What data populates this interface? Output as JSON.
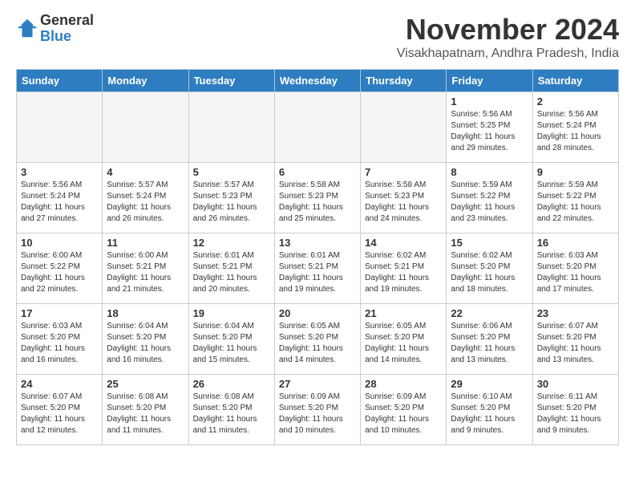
{
  "logo": {
    "general": "General",
    "blue": "Blue"
  },
  "title": "November 2024",
  "location": "Visakhapatnam, Andhra Pradesh, India",
  "weekdays": [
    "Sunday",
    "Monday",
    "Tuesday",
    "Wednesday",
    "Thursday",
    "Friday",
    "Saturday"
  ],
  "weeks": [
    [
      {
        "day": "",
        "info": ""
      },
      {
        "day": "",
        "info": ""
      },
      {
        "day": "",
        "info": ""
      },
      {
        "day": "",
        "info": ""
      },
      {
        "day": "",
        "info": ""
      },
      {
        "day": "1",
        "info": "Sunrise: 5:56 AM\nSunset: 5:25 PM\nDaylight: 11 hours\nand 29 minutes."
      },
      {
        "day": "2",
        "info": "Sunrise: 5:56 AM\nSunset: 5:24 PM\nDaylight: 11 hours\nand 28 minutes."
      }
    ],
    [
      {
        "day": "3",
        "info": "Sunrise: 5:56 AM\nSunset: 5:24 PM\nDaylight: 11 hours\nand 27 minutes."
      },
      {
        "day": "4",
        "info": "Sunrise: 5:57 AM\nSunset: 5:24 PM\nDaylight: 11 hours\nand 26 minutes."
      },
      {
        "day": "5",
        "info": "Sunrise: 5:57 AM\nSunset: 5:23 PM\nDaylight: 11 hours\nand 26 minutes."
      },
      {
        "day": "6",
        "info": "Sunrise: 5:58 AM\nSunset: 5:23 PM\nDaylight: 11 hours\nand 25 minutes."
      },
      {
        "day": "7",
        "info": "Sunrise: 5:58 AM\nSunset: 5:23 PM\nDaylight: 11 hours\nand 24 minutes."
      },
      {
        "day": "8",
        "info": "Sunrise: 5:59 AM\nSunset: 5:22 PM\nDaylight: 11 hours\nand 23 minutes."
      },
      {
        "day": "9",
        "info": "Sunrise: 5:59 AM\nSunset: 5:22 PM\nDaylight: 11 hours\nand 22 minutes."
      }
    ],
    [
      {
        "day": "10",
        "info": "Sunrise: 6:00 AM\nSunset: 5:22 PM\nDaylight: 11 hours\nand 22 minutes."
      },
      {
        "day": "11",
        "info": "Sunrise: 6:00 AM\nSunset: 5:21 PM\nDaylight: 11 hours\nand 21 minutes."
      },
      {
        "day": "12",
        "info": "Sunrise: 6:01 AM\nSunset: 5:21 PM\nDaylight: 11 hours\nand 20 minutes."
      },
      {
        "day": "13",
        "info": "Sunrise: 6:01 AM\nSunset: 5:21 PM\nDaylight: 11 hours\nand 19 minutes."
      },
      {
        "day": "14",
        "info": "Sunrise: 6:02 AM\nSunset: 5:21 PM\nDaylight: 11 hours\nand 19 minutes."
      },
      {
        "day": "15",
        "info": "Sunrise: 6:02 AM\nSunset: 5:20 PM\nDaylight: 11 hours\nand 18 minutes."
      },
      {
        "day": "16",
        "info": "Sunrise: 6:03 AM\nSunset: 5:20 PM\nDaylight: 11 hours\nand 17 minutes."
      }
    ],
    [
      {
        "day": "17",
        "info": "Sunrise: 6:03 AM\nSunset: 5:20 PM\nDaylight: 11 hours\nand 16 minutes."
      },
      {
        "day": "18",
        "info": "Sunrise: 6:04 AM\nSunset: 5:20 PM\nDaylight: 11 hours\nand 16 minutes."
      },
      {
        "day": "19",
        "info": "Sunrise: 6:04 AM\nSunset: 5:20 PM\nDaylight: 11 hours\nand 15 minutes."
      },
      {
        "day": "20",
        "info": "Sunrise: 6:05 AM\nSunset: 5:20 PM\nDaylight: 11 hours\nand 14 minutes."
      },
      {
        "day": "21",
        "info": "Sunrise: 6:05 AM\nSunset: 5:20 PM\nDaylight: 11 hours\nand 14 minutes."
      },
      {
        "day": "22",
        "info": "Sunrise: 6:06 AM\nSunset: 5:20 PM\nDaylight: 11 hours\nand 13 minutes."
      },
      {
        "day": "23",
        "info": "Sunrise: 6:07 AM\nSunset: 5:20 PM\nDaylight: 11 hours\nand 13 minutes."
      }
    ],
    [
      {
        "day": "24",
        "info": "Sunrise: 6:07 AM\nSunset: 5:20 PM\nDaylight: 11 hours\nand 12 minutes."
      },
      {
        "day": "25",
        "info": "Sunrise: 6:08 AM\nSunset: 5:20 PM\nDaylight: 11 hours\nand 11 minutes."
      },
      {
        "day": "26",
        "info": "Sunrise: 6:08 AM\nSunset: 5:20 PM\nDaylight: 11 hours\nand 11 minutes."
      },
      {
        "day": "27",
        "info": "Sunrise: 6:09 AM\nSunset: 5:20 PM\nDaylight: 11 hours\nand 10 minutes."
      },
      {
        "day": "28",
        "info": "Sunrise: 6:09 AM\nSunset: 5:20 PM\nDaylight: 11 hours\nand 10 minutes."
      },
      {
        "day": "29",
        "info": "Sunrise: 6:10 AM\nSunset: 5:20 PM\nDaylight: 11 hours\nand 9 minutes."
      },
      {
        "day": "30",
        "info": "Sunrise: 6:11 AM\nSunset: 5:20 PM\nDaylight: 11 hours\nand 9 minutes."
      }
    ]
  ]
}
